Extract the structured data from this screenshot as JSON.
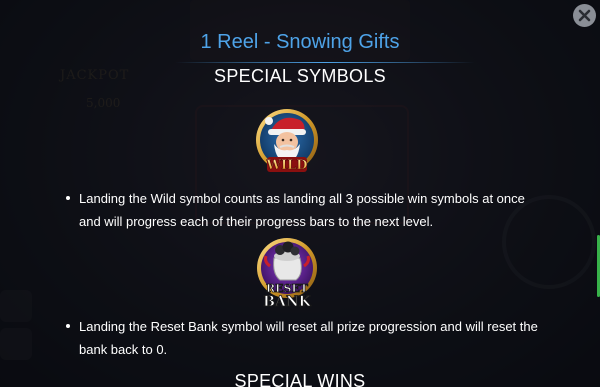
{
  "dialog": {
    "title": "1 Reel - Snowing Gifts",
    "close_icon": "close-icon",
    "accent_color": "#4ea3e8"
  },
  "background": {
    "jackpot_label": "JACKPOT",
    "jackpot_value": "5,000"
  },
  "sections": {
    "special_symbols": {
      "heading": "SPECIAL SYMBOLS",
      "items": [
        {
          "icon": "wild-santa-icon",
          "symbol_label": "WILD",
          "description": "Landing the Wild symbol counts as landing all 3 possible win symbols at once and will progress each of their progress bars to the next level."
        },
        {
          "icon": "reset-bank-icon",
          "symbol_label_line1": "RESET",
          "symbol_label_line2": "BANK",
          "description": "Landing the Reset Bank symbol will reset all prize progression and will reset the bank back to 0."
        }
      ]
    },
    "special_wins": {
      "heading": "SPECIAL WINS"
    }
  }
}
